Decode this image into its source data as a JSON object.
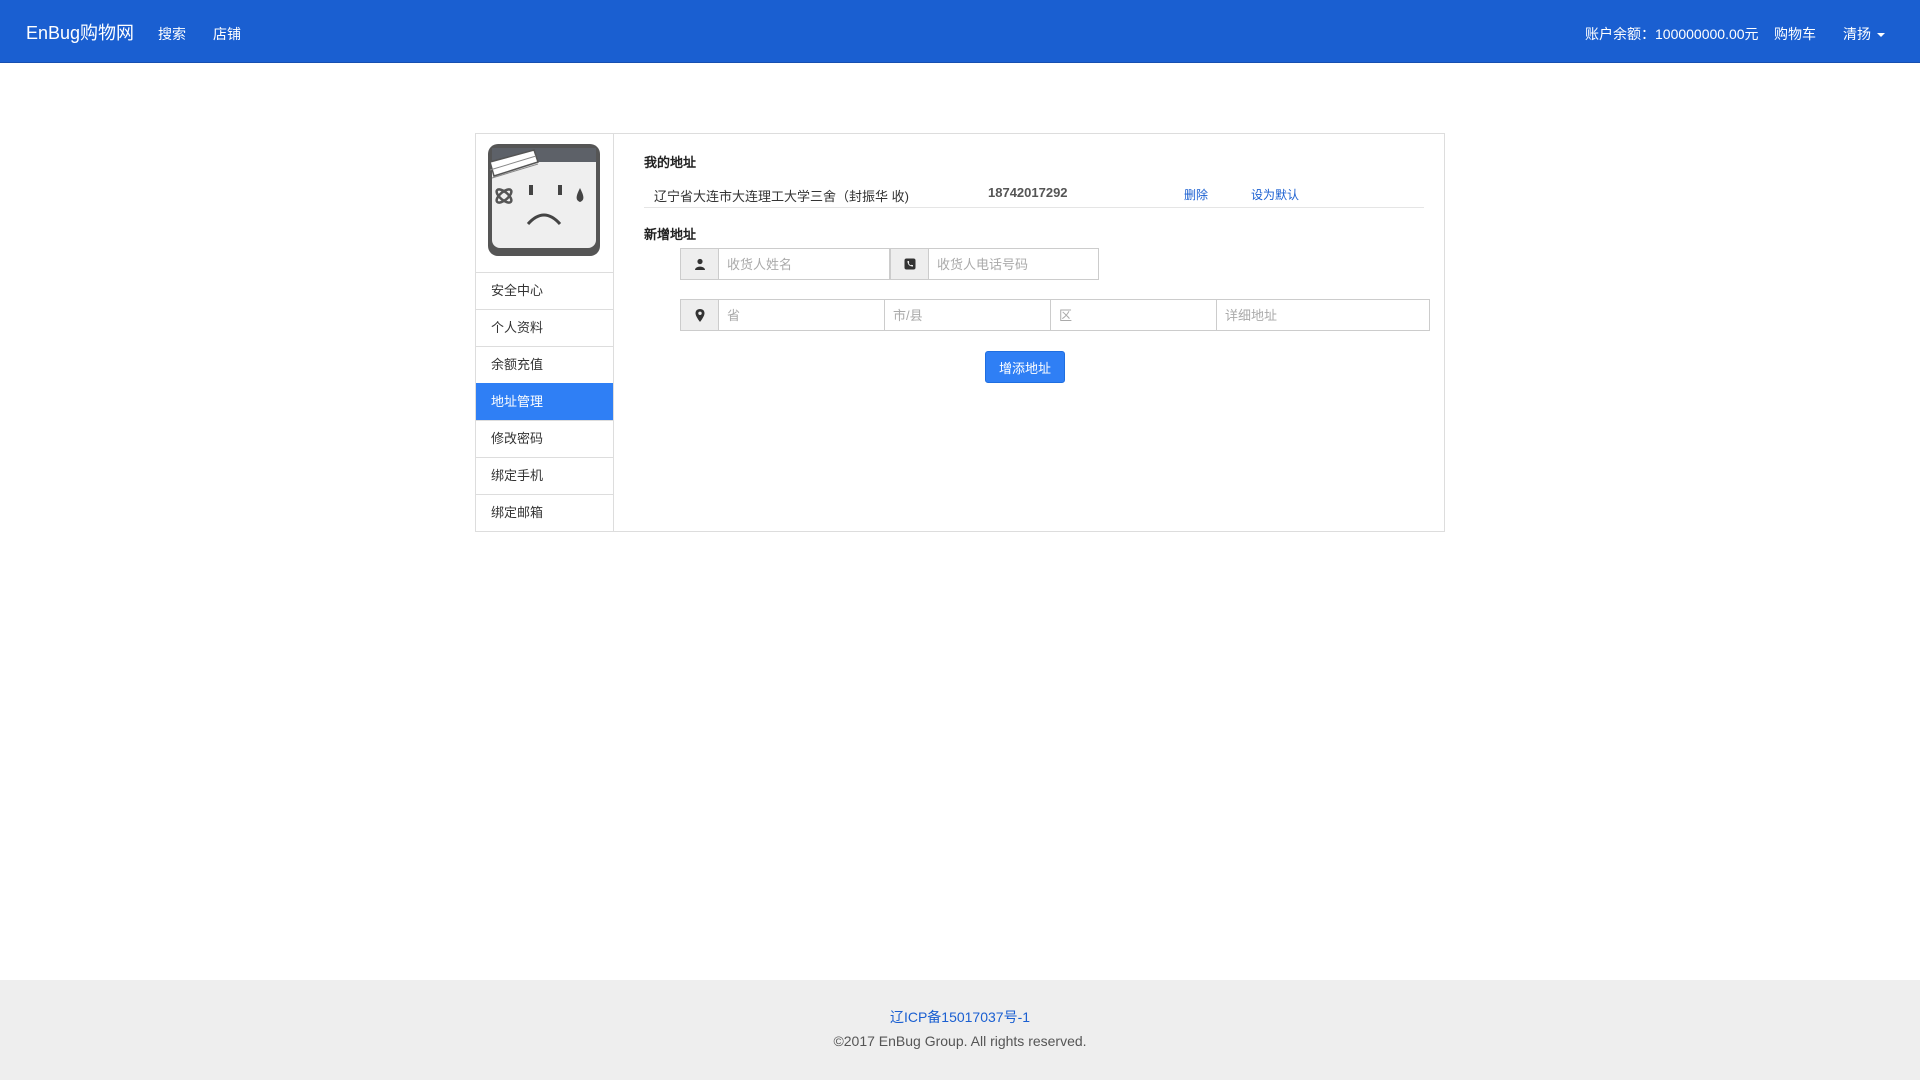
{
  "navbar": {
    "brand": "EnBug购物网",
    "links": [
      "搜索",
      "店铺"
    ],
    "balance": "账户余额：100000000.00元",
    "cart": "购物车",
    "user": "清扬"
  },
  "sidebar": {
    "items": [
      {
        "label": "安全中心"
      },
      {
        "label": "个人资料"
      },
      {
        "label": "余额充值"
      },
      {
        "label": "地址管理"
      },
      {
        "label": "修改密码"
      },
      {
        "label": "绑定手机"
      },
      {
        "label": "绑定邮箱"
      }
    ],
    "active_index": 3
  },
  "addresses": {
    "title": "我的地址",
    "items": [
      {
        "text": "辽宁省大连市大连理工大学三舍（封振华 收)",
        "phone": "18742017292",
        "delete_label": "删除",
        "default_label": "设为默认"
      }
    ]
  },
  "new_address": {
    "title": "新增地址",
    "name_placeholder": "收货人姓名",
    "phone_placeholder": "收货人电话号码",
    "province_placeholder": "省",
    "city_placeholder": "市/县",
    "district_placeholder": "区",
    "detail_placeholder": "详细地址",
    "submit_label": "增添地址"
  },
  "footer": {
    "icp": "辽ICP备15017037号-1",
    "copyright": "©2017 EnBug Group. All rights reserved."
  },
  "colors": {
    "navbar": "#1a5fd1",
    "active": "#2f7ff5"
  }
}
